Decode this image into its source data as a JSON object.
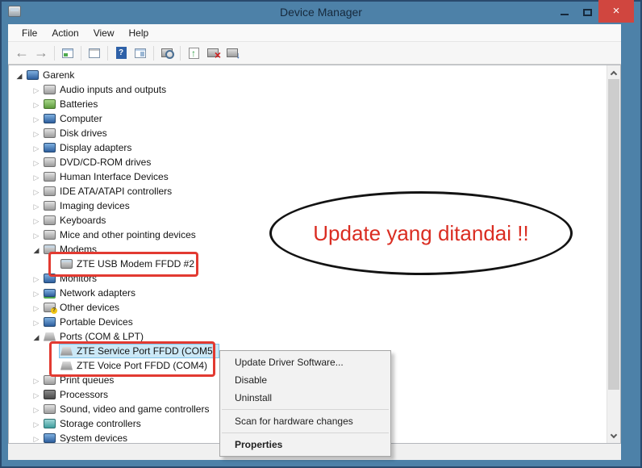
{
  "window": {
    "title": "Device Manager",
    "icon": "device-manager-window-icon"
  },
  "menu_bar": {
    "items": [
      {
        "label": "File",
        "name": "menu-file"
      },
      {
        "label": "Action",
        "name": "menu-action"
      },
      {
        "label": "View",
        "name": "menu-view"
      },
      {
        "label": "Help",
        "name": "menu-help"
      }
    ]
  },
  "toolbar": {
    "items": [
      {
        "name": "toolbar-back-button",
        "icon": "back-icon",
        "classes": "tb-btn",
        "inter": "true"
      },
      {
        "name": "toolbar-forward-button",
        "icon": "forward-icon",
        "classes": "tb-btn",
        "inter": "true"
      },
      {
        "name": "toolbar-separator",
        "classes": "tb-sep",
        "inter": "false"
      },
      {
        "name": "toolbar-console-tree-button",
        "icon": "console-tree-icon",
        "classes": "tb-btn",
        "inter": "true"
      },
      {
        "name": "toolbar-separator",
        "classes": "tb-sep",
        "inter": "false"
      },
      {
        "name": "toolbar-properties-button",
        "icon": "properties-icon",
        "classes": "tb-btn",
        "inter": "true"
      },
      {
        "name": "toolbar-separator",
        "classes": "tb-sep",
        "inter": "false"
      },
      {
        "name": "toolbar-help-button",
        "icon": "help-icon",
        "classes": "tb-btn",
        "inter": "true"
      },
      {
        "name": "toolbar-action-pane-button",
        "icon": "action-pane-icon",
        "classes": "tb-btn",
        "inter": "true"
      },
      {
        "name": "toolbar-separator",
        "classes": "tb-sep",
        "inter": "false"
      },
      {
        "name": "toolbar-search-button",
        "icon": "search-computer-icon",
        "classes": "tb-btn",
        "inter": "true"
      },
      {
        "name": "toolbar-separator",
        "classes": "tb-sep",
        "inter": "false"
      },
      {
        "name": "toolbar-update-driver-button",
        "icon": "update-driver-icon",
        "classes": "tb-btn",
        "inter": "true"
      },
      {
        "name": "toolbar-uninstall-button",
        "icon": "uninstall-icon",
        "classes": "tb-btn",
        "inter": "true"
      },
      {
        "name": "toolbar-scan-hardware-button",
        "icon": "scan-hardware-icon",
        "classes": "tb-btn",
        "inter": "true"
      }
    ]
  },
  "tree": {
    "items": [
      {
        "label": "Garenk",
        "name": "tree-item-garenk",
        "icon": "computer-root-icon",
        "classes": "level-0 expanded"
      },
      {
        "label": "Audio inputs and outputs",
        "name": "tree-item-audio",
        "icon": "audio-icon",
        "classes": "level-1 collapsed"
      },
      {
        "label": "Batteries",
        "name": "tree-item-batteries",
        "icon": "battery-icon",
        "classes": "level-1 collapsed"
      },
      {
        "label": "Computer",
        "name": "tree-item-computer",
        "icon": "computer-icon",
        "classes": "level-1 collapsed"
      },
      {
        "label": "Disk drives",
        "name": "tree-item-disk-drives",
        "icon": "disk-icon",
        "classes": "level-1 collapsed"
      },
      {
        "label": "Display adapters",
        "name": "tree-item-display-adapters",
        "icon": "display-icon",
        "classes": "level-1 collapsed"
      },
      {
        "label": "DVD/CD-ROM drives",
        "name": "tree-item-dvd-drives",
        "icon": "dvd-icon",
        "classes": "level-1 collapsed"
      },
      {
        "label": "Human Interface Devices",
        "name": "tree-item-hid",
        "icon": "hid-icon",
        "classes": "level-1 collapsed"
      },
      {
        "label": "IDE ATA/ATAPI controllers",
        "name": "tree-item-ide",
        "icon": "ide-icon",
        "classes": "level-1 collapsed"
      },
      {
        "label": "Imaging devices",
        "name": "tree-item-imaging",
        "icon": "imaging-icon",
        "classes": "level-1 collapsed"
      },
      {
        "label": "Keyboards",
        "name": "tree-item-keyboards",
        "icon": "keyboard-icon",
        "classes": "level-1 collapsed"
      },
      {
        "label": "Mice and other pointing devices",
        "name": "tree-item-mice",
        "icon": "mouse-icon",
        "classes": "level-1 collapsed"
      },
      {
        "label": "Modems",
        "name": "tree-item-modems",
        "icon": "modem-icon",
        "classes": "level-1 expanded"
      },
      {
        "label": "ZTE USB Modem FFDD #2",
        "name": "tree-item-zte-usb-modem",
        "icon": "modem-icon",
        "classes": "level-2 leaf"
      },
      {
        "label": "Monitors",
        "name": "tree-item-monitors",
        "icon": "monitor-icon",
        "classes": "level-1 collapsed"
      },
      {
        "label": "Network adapters",
        "name": "tree-item-network",
        "icon": "network-icon",
        "classes": "level-1 collapsed"
      },
      {
        "label": "Other devices",
        "name": "tree-item-other-devices",
        "icon": "unknown-device-icon",
        "classes": "level-1 collapsed"
      },
      {
        "label": "Portable Devices",
        "name": "tree-item-portable",
        "icon": "portable-icon",
        "classes": "level-1 collapsed"
      },
      {
        "label": "Ports (COM & LPT)",
        "name": "tree-item-ports",
        "icon": "port-icon",
        "classes": "level-1 expanded"
      },
      {
        "label": "ZTE Service Port FFDD (COM5)",
        "name": "tree-item-zte-service-port",
        "icon": "port-icon",
        "classes": "level-2 leaf selected"
      },
      {
        "label": "ZTE Voice Port FFDD (COM4)",
        "name": "tree-item-zte-voice-port",
        "icon": "port-icon",
        "classes": "level-2 leaf"
      },
      {
        "label": "Print queues",
        "name": "tree-item-print-queues",
        "icon": "printer-icon",
        "classes": "level-1 collapsed"
      },
      {
        "label": "Processors",
        "name": "tree-item-processors",
        "icon": "processor-icon",
        "classes": "level-1 collapsed"
      },
      {
        "label": "Sound, video and game controllers",
        "name": "tree-item-sound",
        "icon": "sound-icon",
        "classes": "level-1 collapsed"
      },
      {
        "label": "Storage controllers",
        "name": "tree-item-storage",
        "icon": "storage-icon",
        "classes": "level-1 collapsed"
      },
      {
        "label": "System devices",
        "name": "tree-item-system-devices",
        "icon": "system-icon",
        "classes": "level-1 collapsed"
      }
    ]
  },
  "context_menu": {
    "items": [
      {
        "label": "Update Driver Software...",
        "name": "context-menu-item-update-driver",
        "classes": "item",
        "inter": "true"
      },
      {
        "label": "Disable",
        "name": "context-menu-item-disable",
        "classes": "item",
        "inter": "true"
      },
      {
        "label": "Uninstall",
        "name": "context-menu-item-uninstall",
        "classes": "item",
        "inter": "true"
      },
      {
        "label": "",
        "name": "context-menu-separator",
        "classes": "separator",
        "inter": "false"
      },
      {
        "label": "Scan for hardware changes",
        "name": "context-menu-item-scan",
        "classes": "item",
        "inter": "true"
      },
      {
        "label": "",
        "name": "context-menu-separator",
        "classes": "separator",
        "inter": "false"
      },
      {
        "label": "Properties",
        "name": "context-menu-item-properties",
        "classes": "item bold",
        "inter": "true"
      }
    ]
  },
  "annotations": {
    "ellipse_label": "Update yang ditandai !!",
    "annotation_text_color": "#da2d22",
    "rect_border_color": "#e23a31",
    "ellipse_border_color": "#131313"
  },
  "colors": {
    "titlebar": "#4d81a8",
    "close_button": "#d0463f",
    "selection_bg": "#cbe8f6",
    "selection_border": "#7fc4ea",
    "context_menu_bg": "#f2f2f2"
  }
}
